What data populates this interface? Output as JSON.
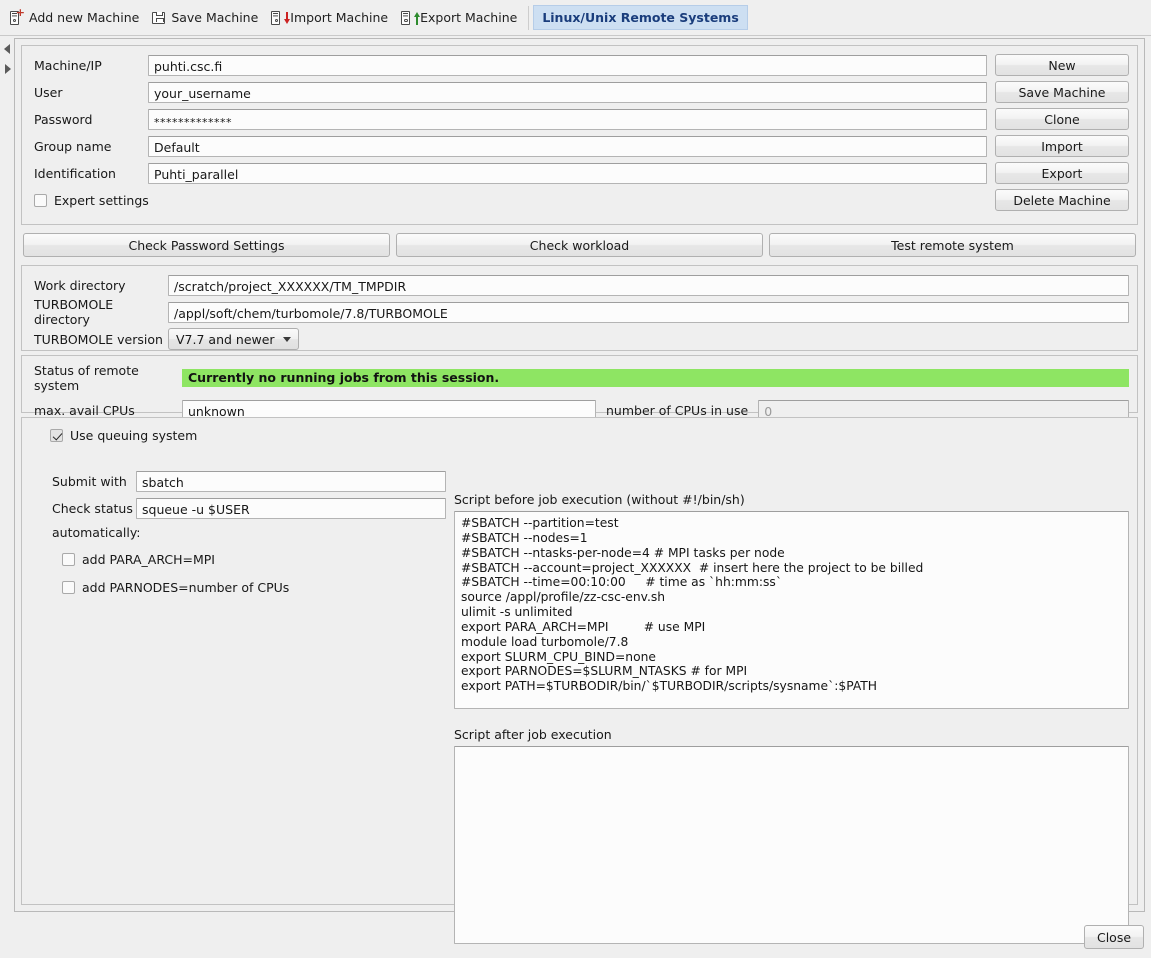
{
  "toolbar": {
    "items": [
      {
        "label": "Add new Machine",
        "icon": "machine-add-icon"
      },
      {
        "label": "Save Machine",
        "icon": "floppy-save-icon"
      },
      {
        "label": "Import Machine",
        "icon": "machine-import-icon"
      },
      {
        "label": "Export Machine",
        "icon": "machine-export-icon"
      }
    ],
    "active_tab": "Linux/Unix Remote Systems"
  },
  "side_nav": {
    "prev_icon": "triangle-left-icon",
    "next_icon": "triangle-right-icon"
  },
  "machine": {
    "fields": [
      {
        "label": "Machine/IP",
        "value": "puhti.csc.fi",
        "name": "machine-ip"
      },
      {
        "label": "User",
        "value": "your_username",
        "name": "user"
      },
      {
        "label": "Password",
        "value": "*************",
        "name": "password"
      },
      {
        "label": "Group name",
        "value": "Default",
        "name": "group-name"
      },
      {
        "label": "Identification",
        "value": "Puhti_parallel",
        "name": "identification"
      }
    ],
    "expert_settings": {
      "label": "Expert settings",
      "checked": false
    }
  },
  "machine_buttons": [
    "New",
    "Save Machine",
    "Clone",
    "Import",
    "Export",
    "Delete Machine"
  ],
  "action_buttons": [
    "Check Password Settings",
    "Check workload",
    "Test remote system"
  ],
  "directories": {
    "work_directory": {
      "label": "Work directory",
      "value": "/scratch/project_XXXXXX/TM_TMPDIR"
    },
    "turbomole_directory": {
      "label": "TURBOMOLE directory",
      "value": "/appl/soft/chem/turbomole/7.8/TURBOMOLE"
    },
    "turbomole_version": {
      "label": "TURBOMOLE version",
      "value": "V7.7 and newer"
    }
  },
  "status": {
    "label": "Status of remote system",
    "message": "Currently no running jobs from this session.",
    "status_color": "#8ee563",
    "cpus_label": "max. avail CPUs",
    "cpus_value": "unknown",
    "cpus_in_use_label": "number of CPUs in use",
    "cpus_in_use_value": "0"
  },
  "queue": {
    "use_queuing_label": "Use queuing system",
    "use_queuing_checked": true,
    "submit_label": "Submit with",
    "submit_value": "sbatch",
    "check_status_label": "Check status",
    "check_status_value": "squeue -u $USER",
    "automatically_label": "automatically:",
    "options": [
      {
        "label": "add PARA_ARCH=MPI",
        "checked": false
      },
      {
        "label": "add PARNODES=number of CPUs",
        "checked": false
      }
    ]
  },
  "scripts": {
    "before_label": "Script before job execution (without #!/bin/sh)",
    "before_value": "#SBATCH --partition=test\n#SBATCH --nodes=1\n#SBATCH --ntasks-per-node=4 # MPI tasks per node\n#SBATCH --account=project_XXXXXX  # insert here the project to be billed\n#SBATCH --time=00:10:00     # time as `hh:mm:ss`\nsource /appl/profile/zz-csc-env.sh\nulimit -s unlimited\nexport PARA_ARCH=MPI         # use MPI\nmodule load turbomole/7.8\nexport SLURM_CPU_BIND=none\nexport PARNODES=$SLURM_NTASKS # for MPI\nexport PATH=$TURBODIR/bin/`$TURBODIR/scripts/sysname`:$PATH",
    "after_label": "Script after job execution",
    "after_value": ""
  },
  "footer": {
    "close_label": "Close"
  }
}
